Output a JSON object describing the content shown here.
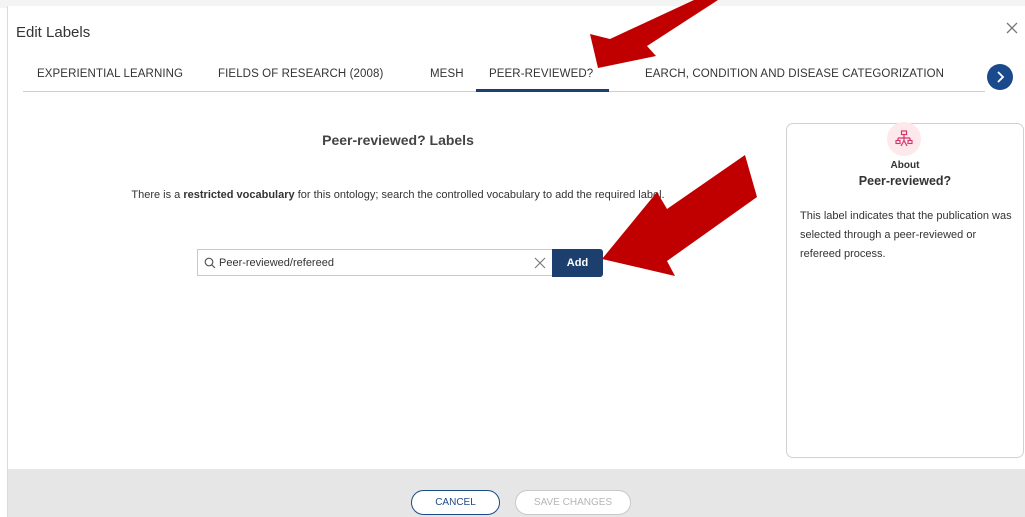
{
  "dialog": {
    "title": "Edit Labels"
  },
  "tabs": [
    {
      "label": "EXPERIENTIAL LEARNING"
    },
    {
      "label": "FIELDS OF RESEARCH (2008)"
    },
    {
      "label": "MESH"
    },
    {
      "label": "PEER-REVIEWED?"
    },
    {
      "label": "EARCH, CONDITION AND DISEASE CATEGORIZATION"
    }
  ],
  "active_tab": "PEER-REVIEWED?",
  "main": {
    "heading": "Peer-reviewed? Labels",
    "description_prefix": "There is a ",
    "description_emph": "restricted vocabulary",
    "description_suffix": " for this ontology; search the controlled vocabulary to add the required label.",
    "search": {
      "value": "Peer-reviewed/refereed",
      "placeholder": ""
    },
    "add_label": "Add"
  },
  "about": {
    "kicker": "About",
    "title": "Peer-reviewed?",
    "text": "This label indicates that the publication was selected through a peer-reviewed or refereed process."
  },
  "footer": {
    "cancel_label": "CANCEL",
    "save_label": "SAVE CHANGES"
  },
  "colors": {
    "primary": "#1c3f6d",
    "annotation_arrow": "#c00000",
    "about_icon_bg": "#fde8ec",
    "about_icon": "#d6336c"
  }
}
